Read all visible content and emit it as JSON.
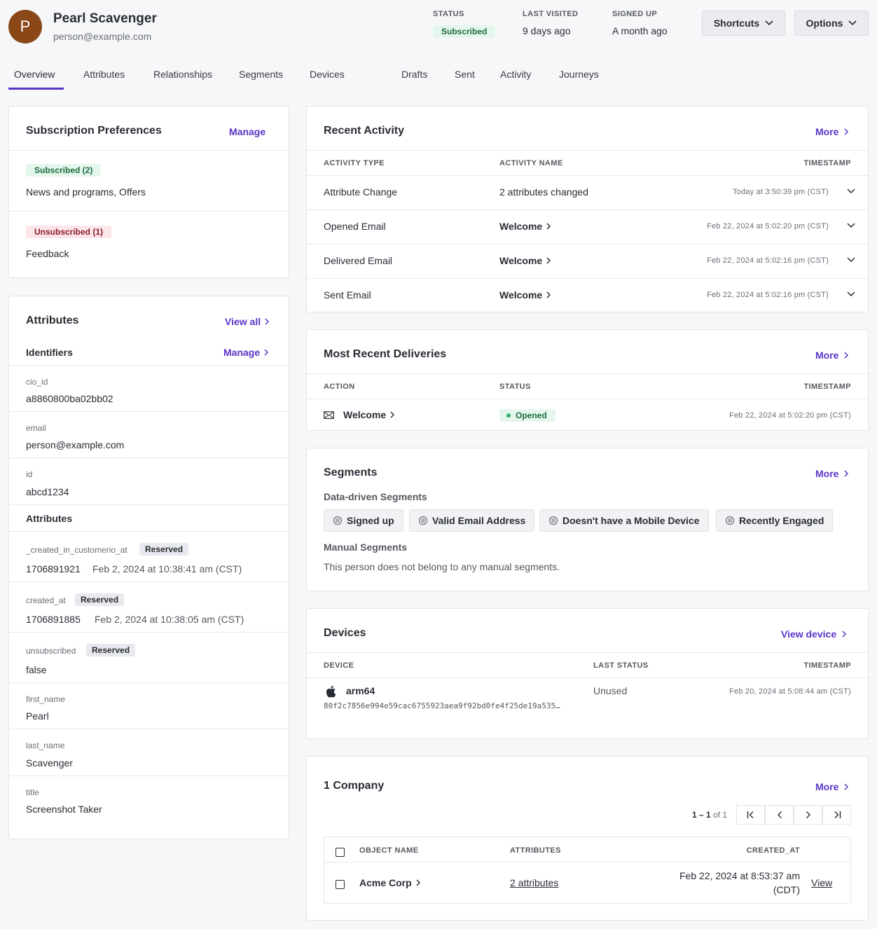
{
  "person": {
    "initial": "P",
    "name": "Pearl Scavenger",
    "email": "person@example.com"
  },
  "stats": {
    "status": {
      "label": "STATUS",
      "value": "Subscribed"
    },
    "last_visited": {
      "label": "LAST VISITED",
      "value": "9 days ago"
    },
    "signed_up": {
      "label": "SIGNED UP",
      "value": "A month ago"
    }
  },
  "header_buttons": {
    "shortcuts": "Shortcuts",
    "options": "Options"
  },
  "tabs": [
    "Overview",
    "Attributes",
    "Relationships",
    "Segments",
    "Devices",
    "Drafts",
    "Sent",
    "Activity",
    "Journeys"
  ],
  "subscription": {
    "title": "Subscription Preferences",
    "manage": "Manage",
    "subscribed_badge": "Subscribed (2)",
    "subscribed_topics": "News and programs, Offers",
    "unsubscribed_badge": "Unsubscribed (1)",
    "unsubscribed_topics": "Feedback"
  },
  "attributes": {
    "title": "Attributes",
    "view_all": "View all",
    "identifiers_title": "Identifiers",
    "identifiers_manage": "Manage",
    "identifiers": [
      {
        "key": "cio_id",
        "value": "a8860800ba02bb02"
      },
      {
        "key": "email",
        "value": "person@example.com"
      },
      {
        "key": "id",
        "value": "abcd1234"
      }
    ],
    "attributes_title": "Attributes",
    "reserved_label": "Reserved",
    "items": [
      {
        "key": "_created_in_customerio_at",
        "value": "1706891921",
        "detail": "Feb 2, 2024 at 10:38:41 am (CST)"
      },
      {
        "key": "created_at",
        "value": "1706891885",
        "detail": "Feb 2, 2024 at 10:38:05 am (CST)"
      },
      {
        "key": "unsubscribed",
        "value": "false"
      },
      {
        "key": "first_name",
        "value": "Pearl"
      },
      {
        "key": "last_name",
        "value": "Scavenger"
      },
      {
        "key": "title",
        "value": "Screenshot Taker"
      }
    ]
  },
  "recent_activity": {
    "title": "Recent Activity",
    "more": "More",
    "columns": [
      "ACTIVITY TYPE",
      "ACTIVITY NAME",
      "TIMESTAMP"
    ],
    "rows": [
      {
        "type": "Attribute Change",
        "name": "2 attributes changed",
        "timestamp": "Today at 3:50:39 pm (CST)"
      },
      {
        "type": "Opened Email",
        "name": "Welcome",
        "timestamp": "Feb 22, 2024 at 5:02:20 pm (CST)"
      },
      {
        "type": "Delivered Email",
        "name": "Welcome",
        "timestamp": "Feb 22, 2024 at 5:02:16 pm (CST)"
      },
      {
        "type": "Sent Email",
        "name": "Welcome",
        "timestamp": "Feb 22, 2024 at 5:02:16 pm (CST)"
      }
    ]
  },
  "deliveries": {
    "title": "Most Recent Deliveries",
    "more": "More",
    "columns": [
      "ACTION",
      "STATUS",
      "TIMESTAMP"
    ],
    "row": {
      "action": "Welcome",
      "status": "Opened",
      "timestamp": "Feb 22, 2024 at 5:02:20 pm (CST)"
    }
  },
  "segments": {
    "title": "Segments",
    "more": "More",
    "data_driven_title": "Data-driven Segments",
    "data_driven": [
      "Signed up",
      "Valid Email Address",
      "Doesn't have a Mobile Device",
      "Recently Engaged"
    ],
    "manual_title": "Manual Segments",
    "manual_empty": "This person does not belong to any manual segments."
  },
  "devices": {
    "title": "Devices",
    "view_device": "View device",
    "columns": [
      "DEVICE",
      "LAST STATUS",
      "TIMESTAMP"
    ],
    "row": {
      "name": "arm64",
      "token": "80f2c7856e994e59cac6755923aea9f92bd0fe4f25de19a535…",
      "status": "Unused",
      "timestamp": "Feb 20, 2024 at 5:08:44 am (CST)"
    }
  },
  "companies": {
    "title": "1 Company",
    "more": "More",
    "pagination_range": "1 – 1",
    "pagination_of": "of 1",
    "columns": [
      "OBJECT NAME",
      "ATTRIBUTES",
      "CREATED_AT"
    ],
    "row": {
      "name": "Acme Corp",
      "attributes": "2 attributes",
      "created_line1": "Feb 22, 2024 at 8:53:37 am",
      "created_line2": "(CDT)",
      "view": "View"
    }
  },
  "colors": {
    "accent": "#5a34c8",
    "avatar": "#8a4818",
    "success": "#1c6b3f",
    "danger": "#8a1a2f"
  }
}
